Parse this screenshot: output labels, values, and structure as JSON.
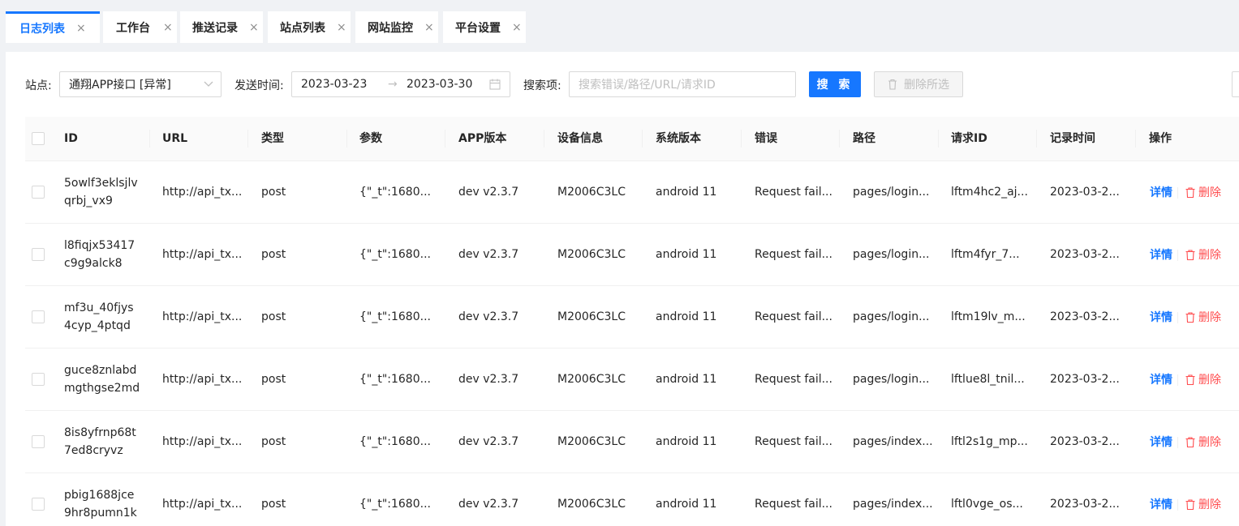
{
  "tabs": [
    {
      "label": "日志列表",
      "close": "×",
      "active": true
    },
    {
      "label": "工作台",
      "close": "×",
      "active": false
    },
    {
      "label": "推送记录",
      "close": "×",
      "active": false
    },
    {
      "label": "站点列表",
      "close": "×",
      "active": false
    },
    {
      "label": "网站监控",
      "close": "×",
      "active": false
    },
    {
      "label": "平台设置",
      "close": "×",
      "active": false
    }
  ],
  "filters": {
    "site_label": "站点:",
    "site_value": "通翔APP接口 [异常]",
    "time_label": "发送时间:",
    "date_start": "2023-03-23",
    "date_arrow": "→",
    "date_end": "2023-03-30",
    "search_label": "搜索项:",
    "search_placeholder": "搜索错误/路径/URL/请求ID",
    "search_button": "搜 索",
    "delete_selected_button": "删除所选"
  },
  "table": {
    "columns": [
      "ID",
      "URL",
      "类型",
      "参数",
      "APP版本",
      "设备信息",
      "系统版本",
      "错误",
      "路径",
      "请求ID",
      "记录时间",
      "操作"
    ],
    "rows": [
      {
        "id": "5owlf3eklsjlv qrbj_vx9",
        "url": "http://api_tx...",
        "type": "post",
        "params": "{\"_t\":1680...",
        "app_version": "dev v2.3.7",
        "device": "M2006C3LC",
        "os": "android 11",
        "error": "Request fail...",
        "path": "pages/login...",
        "request_id": "lftm4hc2_aj...",
        "time": "2023-03-2..."
      },
      {
        "id": "l8fiqjx53417 c9g9alck8",
        "url": "http://api_tx...",
        "type": "post",
        "params": "{\"_t\":1680...",
        "app_version": "dev v2.3.7",
        "device": "M2006C3LC",
        "os": "android 11",
        "error": "Request fail...",
        "path": "pages/login...",
        "request_id": "lftm4fyr_7...",
        "time": "2023-03-2..."
      },
      {
        "id": "mf3u_40fjys 4cyp_4ptqd",
        "url": "http://api_tx...",
        "type": "post",
        "params": "{\"_t\":1680...",
        "app_version": "dev v2.3.7",
        "device": "M2006C3LC",
        "os": "android 11",
        "error": "Request fail...",
        "path": "pages/login...",
        "request_id": "lftm19lv_m...",
        "time": "2023-03-2..."
      },
      {
        "id": "guce8znlabd mgthgse2md",
        "url": "http://api_tx...",
        "type": "post",
        "params": "{\"_t\":1680...",
        "app_version": "dev v2.3.7",
        "device": "M2006C3LC",
        "os": "android 11",
        "error": "Request fail...",
        "path": "pages/login...",
        "request_id": "lftlue8l_tnil...",
        "time": "2023-03-2..."
      },
      {
        "id": "8is8yfrnp68t 7ed8cryvz",
        "url": "http://api_tx...",
        "type": "post",
        "params": "{\"_t\":1680...",
        "app_version": "dev v2.3.7",
        "device": "M2006C3LC",
        "os": "android 11",
        "error": "Request fail...",
        "path": "pages/index...",
        "request_id": "lftl2s1g_mp...",
        "time": "2023-03-2..."
      },
      {
        "id": "pbig1688jce 9hr8pumn1k",
        "url": "http://api_tx...",
        "type": "post",
        "params": "{\"_t\":1680...",
        "app_version": "dev v2.3.7",
        "device": "M2006C3LC",
        "os": "android 11",
        "error": "Request fail...",
        "path": "pages/index...",
        "request_id": "lftl0vge_os...",
        "time": "2023-03-2..."
      }
    ],
    "detail_label": "详情",
    "delete_label": "删除"
  },
  "colors": {
    "primary": "#1677ff",
    "danger": "#ff4d4f",
    "page_bg": "#f0f2f5"
  }
}
